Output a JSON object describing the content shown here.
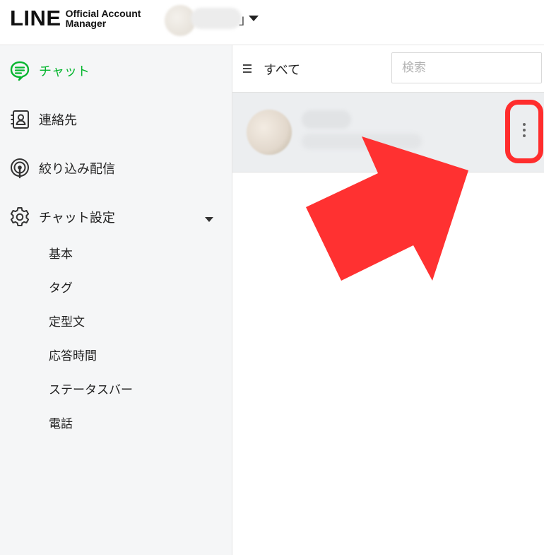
{
  "header": {
    "logo_main": "LINE",
    "logo_sub_line1": "Official Account",
    "logo_sub_line2": "Manager",
    "account_name_visible_tail": "｣"
  },
  "sidebar": {
    "items": [
      {
        "label": "チャット",
        "icon": "chat-bubble-icon",
        "active": true
      },
      {
        "label": "連絡先",
        "icon": "contacts-book-icon",
        "active": false
      },
      {
        "label": "絞り込み配信",
        "icon": "broadcast-signal-icon",
        "active": false
      },
      {
        "label": "チャット設定",
        "icon": "gear-icon",
        "active": false
      }
    ],
    "settings_sub_items": [
      "基本",
      "タグ",
      "定型文",
      "応答時間",
      "ステータスバー",
      "電話"
    ]
  },
  "main": {
    "filter_label": "すべて",
    "filter_icon": "hamburger-menu-icon",
    "search_placeholder": "検索",
    "chat_list": [
      {
        "more_icon": "vertical-ellipsis-icon"
      }
    ]
  },
  "colors": {
    "accent_green": "#06b62f",
    "highlight_red": "#ff2d2d",
    "sidebar_bg": "#f5f6f7",
    "selected_row_bg": "#eceef0"
  }
}
